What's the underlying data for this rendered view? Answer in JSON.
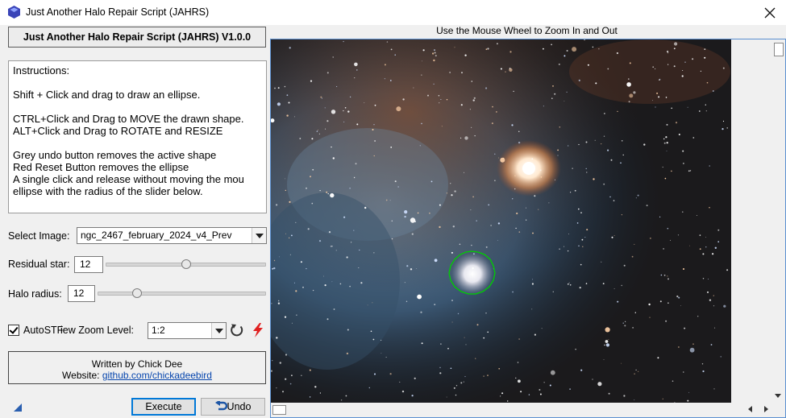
{
  "window": {
    "title": "Just Another Halo Repair Script (JAHRS)",
    "close_glyph": "X",
    "app_icon": "pixinsight-icon"
  },
  "header": {
    "title": "Just Another Halo Repair Script (JAHRS) V1.0.0"
  },
  "instructions": {
    "lines": [
      "Instructions:",
      "Shift + Click and drag to draw an ellipse.",
      "CTRL+Click and Drag to MOVE the drawn shape.",
      "ALT+Click and Drag to ROTATE and RESIZE",
      "Grey undo button removes the active shape",
      "Red Reset Button removes the ellipse",
      "A single click and release without moving the mou",
      "ellipse with the radius of the slider below."
    ]
  },
  "select_image": {
    "label": "Select Image:",
    "value": "ngc_2467_february_2024_v4_Prev"
  },
  "residual_star": {
    "label": "Residual star:",
    "value": "12",
    "slider_fraction": 0.5
  },
  "halo_radius": {
    "label": "Halo radius:",
    "value": "12",
    "slider_fraction": 0.23
  },
  "autostf": {
    "label": "AutoSTF",
    "checked": true,
    "zoom_label": "iew Zoom Level:",
    "zoom_value": "1:2",
    "undo_icon": "circular-arrow-icon",
    "reset_icon": "red-lightning-icon"
  },
  "credits": {
    "written_by": "Written by Chick Dee",
    "website_label": "Website:",
    "website_link": "github.com/chickadeebird"
  },
  "buttons": {
    "execute": "Execute",
    "undo": "Undo"
  },
  "viewer": {
    "caption": "Use the Mouse Wheel to Zoom In and Out",
    "selection_color": "#00d000"
  },
  "colors": {
    "accent": "#0078d7",
    "selection": "#00d000",
    "reset": "#e02020"
  }
}
